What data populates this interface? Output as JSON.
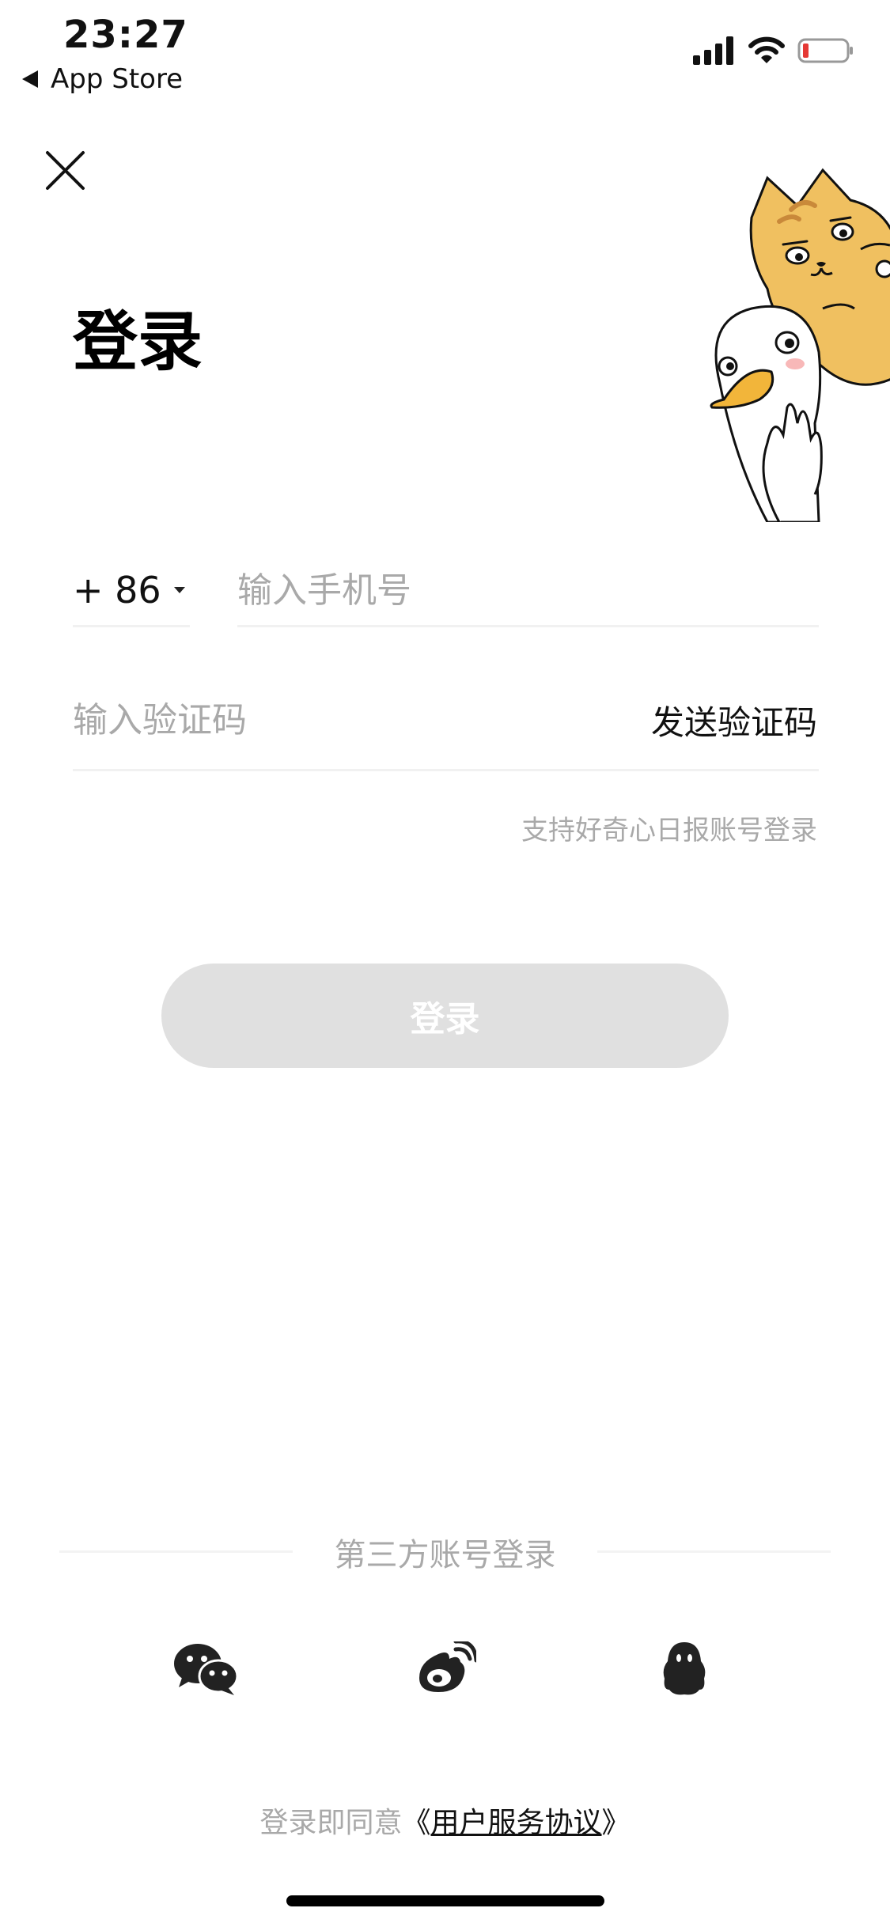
{
  "status_bar": {
    "time": "23:27",
    "back_app": "App Store"
  },
  "title": "登录",
  "phone": {
    "country_code": "+ 86",
    "placeholder": "输入手机号"
  },
  "code": {
    "placeholder": "输入验证码",
    "send_label": "发送验证码"
  },
  "support_text": "支持好奇心日报账号登录",
  "login_button": "登录",
  "third_party": {
    "title": "第三方账号登录",
    "providers": [
      {
        "name": "wechat",
        "icon": "wechat-icon"
      },
      {
        "name": "weibo",
        "icon": "weibo-icon"
      },
      {
        "name": "qq",
        "icon": "qq-icon"
      }
    ]
  },
  "agreement": {
    "prefix": "登录即同意",
    "open": "《",
    "link": "用户服务协议",
    "close": "》"
  },
  "colors": {
    "primary_text": "#111111",
    "placeholder": "#a9a9a9",
    "button_disabled": "#e0e0e0",
    "cat": "#f0c060",
    "beak": "#f2b53a",
    "battery_low": "#e53935"
  }
}
